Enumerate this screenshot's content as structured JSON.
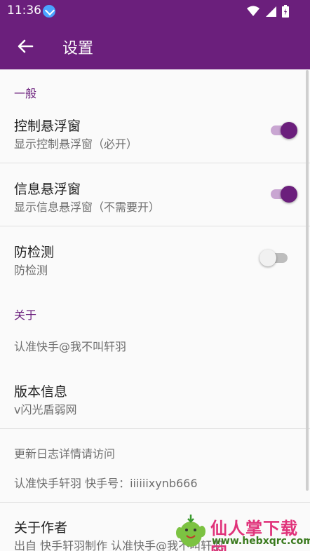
{
  "status_bar": {
    "time": "11:36",
    "icons": [
      "download-icon",
      "wifi-icon",
      "signal-icon",
      "battery-charging-icon"
    ]
  },
  "toolbar": {
    "title": "设置",
    "back_icon": "arrow-left-icon"
  },
  "sections": [
    {
      "header": "一般",
      "items": [
        {
          "title": "控制悬浮窗",
          "summary": "显示控制悬浮窗（必开）",
          "switch_on": true
        },
        {
          "title": "信息悬浮窗",
          "summary": "显示信息悬浮窗（不需要开）",
          "switch_on": true
        },
        {
          "title": "防检测",
          "summary": "防检测",
          "switch_on": false
        }
      ]
    },
    {
      "header": "关于",
      "items": [
        {
          "summary": "认准快手@我不叫轩羽"
        },
        {
          "title": "版本信息",
          "summary": "v闪光盾弱网"
        },
        {
          "summary": "更新日志详情请访问"
        },
        {
          "summary": "认准快手轩羽 快手号：iiiiiixynb666"
        },
        {
          "title": "关于作者",
          "summary": "出自 快手轩羽制作 认准快手@我不叫轩羽"
        }
      ]
    }
  ],
  "watermark": {
    "text": "仙人掌下载网",
    "url": "www.hebxqrc.com"
  },
  "colors": {
    "accent": "#6b1f7c",
    "switch_track_on": "#c9a6d2",
    "switch_thumb_off": "#f1f1f1",
    "watermark_text": "#e0337a",
    "watermark_url": "#3a7a1e"
  }
}
